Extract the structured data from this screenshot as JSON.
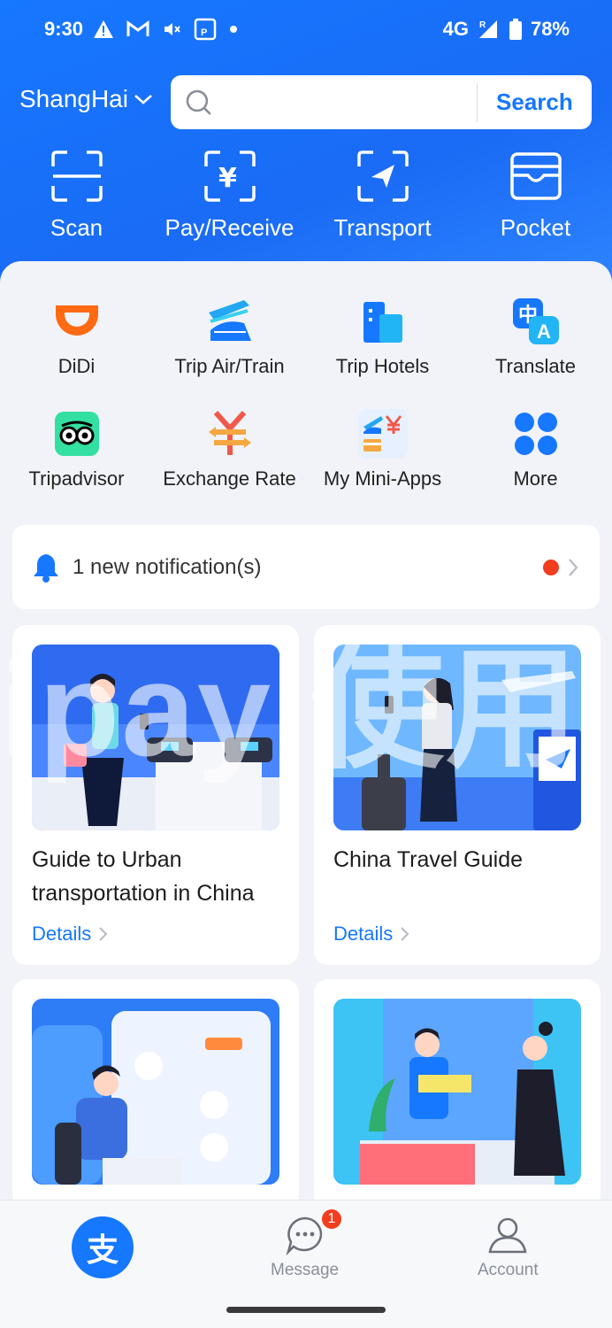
{
  "status_bar": {
    "time": "9:30",
    "network": "4G",
    "roaming": "R",
    "battery": "78%"
  },
  "location": {
    "city": "ShangHai"
  },
  "search": {
    "placeholder": "",
    "button": "Search"
  },
  "quick_actions": [
    {
      "label": "Scan",
      "icon": "scan-icon"
    },
    {
      "label": "Pay/Receive",
      "icon": "pay-receive-icon"
    },
    {
      "label": "Transport",
      "icon": "transport-icon"
    },
    {
      "label": "Pocket",
      "icon": "pocket-icon"
    }
  ],
  "apps": [
    {
      "label": "DiDi",
      "icon": "didi-icon"
    },
    {
      "label": "Trip Air/Train",
      "icon": "trip-air-train-icon"
    },
    {
      "label": "Trip Hotels",
      "icon": "trip-hotels-icon"
    },
    {
      "label": "Translate",
      "icon": "translate-icon"
    },
    {
      "label": "Tripadvisor",
      "icon": "tripadvisor-icon"
    },
    {
      "label": "Exchange Rate",
      "icon": "exchange-rate-icon"
    },
    {
      "label": "My Mini-Apps",
      "icon": "mini-apps-icon"
    },
    {
      "label": "More",
      "icon": "more-icon"
    }
  ],
  "notification": {
    "text": "1 new notification(s)"
  },
  "watermark": "ipay 使用",
  "cards": [
    {
      "title": "Guide to Urban transportation in China",
      "details": "Details"
    },
    {
      "title": "China Travel Guide",
      "details": "Details"
    }
  ],
  "bottom_nav": {
    "message": "Message",
    "account": "Account",
    "message_badge": "1",
    "home_glyph": "支"
  },
  "colors": {
    "brand": "#1677ff",
    "badge": "#f23d1f"
  }
}
